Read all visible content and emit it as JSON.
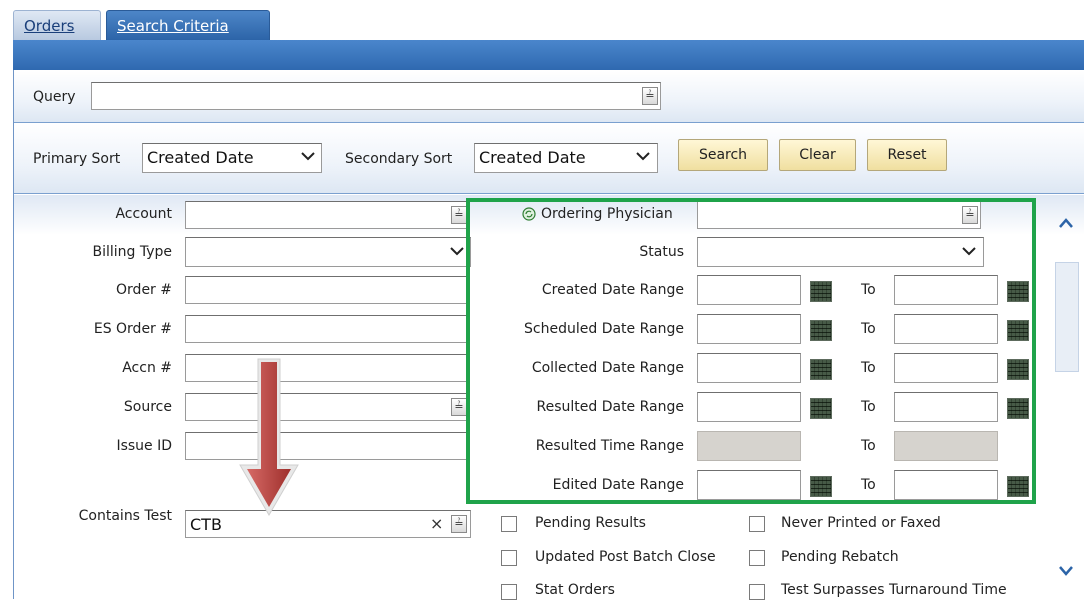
{
  "tabs": {
    "orders": "Orders",
    "search_criteria": "Search Criteria"
  },
  "query": {
    "label": "Query",
    "value": ""
  },
  "sort": {
    "primary_label": "Primary Sort",
    "primary_value": "Created Date",
    "secondary_label": "Secondary Sort",
    "secondary_value": "Created Date",
    "search_label": "Search",
    "clear_label": "Clear",
    "reset_label": "Reset"
  },
  "left": {
    "account": "Account",
    "billing_type": "Billing Type",
    "order_num": "Order #",
    "es_order_num": "ES Order #",
    "accn_num": "Accn #",
    "source": "Source",
    "issue_id": "Issue ID",
    "contains_test": "Contains Test",
    "contains_test_value": "CTB",
    "clear_glyph": "×"
  },
  "right": {
    "ordering_physician": "Ordering Physician",
    "status": "Status",
    "created_range": "Created Date Range",
    "scheduled_range": "Scheduled Date Range",
    "collected_range": "Collected Date Range",
    "resulted_range": "Resulted Date Range",
    "resulted_time_range": "Resulted Time Range",
    "edited_range": "Edited Date Range",
    "to": "To"
  },
  "checkboxes": {
    "pending_results": "Pending Results",
    "updated_post_batch": "Updated Post Batch Close",
    "stat_orders": "Stat Orders",
    "never_printed": "Never Printed or Faxed",
    "pending_rebatch": "Pending Rebatch",
    "test_surpasses": "Test Surpasses Turnaround Time"
  },
  "icons": {
    "combo": "double-chevron-down-icon",
    "dropdown": "chevron-down-icon",
    "calendar": "calendar-icon",
    "physician": "lookup-icon",
    "annotation_arrow": "down-arrow-icon"
  },
  "colors": {
    "highlight": "#1fa34a",
    "arrow": "#b8413e",
    "tab_active": "#2c64a8"
  }
}
